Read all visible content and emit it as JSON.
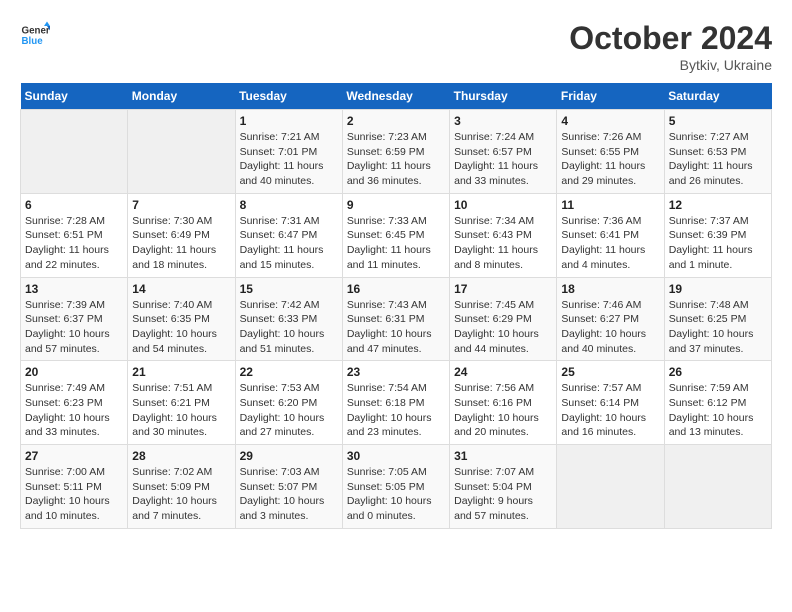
{
  "logo": {
    "line1": "General",
    "line2": "Blue"
  },
  "title": "October 2024",
  "subtitle": "Bytkiv, Ukraine",
  "weekdays": [
    "Sunday",
    "Monday",
    "Tuesday",
    "Wednesday",
    "Thursday",
    "Friday",
    "Saturday"
  ],
  "weeks": [
    [
      {
        "day": "",
        "sunrise": "",
        "sunset": "",
        "daylight": ""
      },
      {
        "day": "",
        "sunrise": "",
        "sunset": "",
        "daylight": ""
      },
      {
        "day": "1",
        "sunrise": "Sunrise: 7:21 AM",
        "sunset": "Sunset: 7:01 PM",
        "daylight": "Daylight: 11 hours and 40 minutes."
      },
      {
        "day": "2",
        "sunrise": "Sunrise: 7:23 AM",
        "sunset": "Sunset: 6:59 PM",
        "daylight": "Daylight: 11 hours and 36 minutes."
      },
      {
        "day": "3",
        "sunrise": "Sunrise: 7:24 AM",
        "sunset": "Sunset: 6:57 PM",
        "daylight": "Daylight: 11 hours and 33 minutes."
      },
      {
        "day": "4",
        "sunrise": "Sunrise: 7:26 AM",
        "sunset": "Sunset: 6:55 PM",
        "daylight": "Daylight: 11 hours and 29 minutes."
      },
      {
        "day": "5",
        "sunrise": "Sunrise: 7:27 AM",
        "sunset": "Sunset: 6:53 PM",
        "daylight": "Daylight: 11 hours and 26 minutes."
      }
    ],
    [
      {
        "day": "6",
        "sunrise": "Sunrise: 7:28 AM",
        "sunset": "Sunset: 6:51 PM",
        "daylight": "Daylight: 11 hours and 22 minutes."
      },
      {
        "day": "7",
        "sunrise": "Sunrise: 7:30 AM",
        "sunset": "Sunset: 6:49 PM",
        "daylight": "Daylight: 11 hours and 18 minutes."
      },
      {
        "day": "8",
        "sunrise": "Sunrise: 7:31 AM",
        "sunset": "Sunset: 6:47 PM",
        "daylight": "Daylight: 11 hours and 15 minutes."
      },
      {
        "day": "9",
        "sunrise": "Sunrise: 7:33 AM",
        "sunset": "Sunset: 6:45 PM",
        "daylight": "Daylight: 11 hours and 11 minutes."
      },
      {
        "day": "10",
        "sunrise": "Sunrise: 7:34 AM",
        "sunset": "Sunset: 6:43 PM",
        "daylight": "Daylight: 11 hours and 8 minutes."
      },
      {
        "day": "11",
        "sunrise": "Sunrise: 7:36 AM",
        "sunset": "Sunset: 6:41 PM",
        "daylight": "Daylight: 11 hours and 4 minutes."
      },
      {
        "day": "12",
        "sunrise": "Sunrise: 7:37 AM",
        "sunset": "Sunset: 6:39 PM",
        "daylight": "Daylight: 11 hours and 1 minute."
      }
    ],
    [
      {
        "day": "13",
        "sunrise": "Sunrise: 7:39 AM",
        "sunset": "Sunset: 6:37 PM",
        "daylight": "Daylight: 10 hours and 57 minutes."
      },
      {
        "day": "14",
        "sunrise": "Sunrise: 7:40 AM",
        "sunset": "Sunset: 6:35 PM",
        "daylight": "Daylight: 10 hours and 54 minutes."
      },
      {
        "day": "15",
        "sunrise": "Sunrise: 7:42 AM",
        "sunset": "Sunset: 6:33 PM",
        "daylight": "Daylight: 10 hours and 51 minutes."
      },
      {
        "day": "16",
        "sunrise": "Sunrise: 7:43 AM",
        "sunset": "Sunset: 6:31 PM",
        "daylight": "Daylight: 10 hours and 47 minutes."
      },
      {
        "day": "17",
        "sunrise": "Sunrise: 7:45 AM",
        "sunset": "Sunset: 6:29 PM",
        "daylight": "Daylight: 10 hours and 44 minutes."
      },
      {
        "day": "18",
        "sunrise": "Sunrise: 7:46 AM",
        "sunset": "Sunset: 6:27 PM",
        "daylight": "Daylight: 10 hours and 40 minutes."
      },
      {
        "day": "19",
        "sunrise": "Sunrise: 7:48 AM",
        "sunset": "Sunset: 6:25 PM",
        "daylight": "Daylight: 10 hours and 37 minutes."
      }
    ],
    [
      {
        "day": "20",
        "sunrise": "Sunrise: 7:49 AM",
        "sunset": "Sunset: 6:23 PM",
        "daylight": "Daylight: 10 hours and 33 minutes."
      },
      {
        "day": "21",
        "sunrise": "Sunrise: 7:51 AM",
        "sunset": "Sunset: 6:21 PM",
        "daylight": "Daylight: 10 hours and 30 minutes."
      },
      {
        "day": "22",
        "sunrise": "Sunrise: 7:53 AM",
        "sunset": "Sunset: 6:20 PM",
        "daylight": "Daylight: 10 hours and 27 minutes."
      },
      {
        "day": "23",
        "sunrise": "Sunrise: 7:54 AM",
        "sunset": "Sunset: 6:18 PM",
        "daylight": "Daylight: 10 hours and 23 minutes."
      },
      {
        "day": "24",
        "sunrise": "Sunrise: 7:56 AM",
        "sunset": "Sunset: 6:16 PM",
        "daylight": "Daylight: 10 hours and 20 minutes."
      },
      {
        "day": "25",
        "sunrise": "Sunrise: 7:57 AM",
        "sunset": "Sunset: 6:14 PM",
        "daylight": "Daylight: 10 hours and 16 minutes."
      },
      {
        "day": "26",
        "sunrise": "Sunrise: 7:59 AM",
        "sunset": "Sunset: 6:12 PM",
        "daylight": "Daylight: 10 hours and 13 minutes."
      }
    ],
    [
      {
        "day": "27",
        "sunrise": "Sunrise: 7:00 AM",
        "sunset": "Sunset: 5:11 PM",
        "daylight": "Daylight: 10 hours and 10 minutes."
      },
      {
        "day": "28",
        "sunrise": "Sunrise: 7:02 AM",
        "sunset": "Sunset: 5:09 PM",
        "daylight": "Daylight: 10 hours and 7 minutes."
      },
      {
        "day": "29",
        "sunrise": "Sunrise: 7:03 AM",
        "sunset": "Sunset: 5:07 PM",
        "daylight": "Daylight: 10 hours and 3 minutes."
      },
      {
        "day": "30",
        "sunrise": "Sunrise: 7:05 AM",
        "sunset": "Sunset: 5:05 PM",
        "daylight": "Daylight: 10 hours and 0 minutes."
      },
      {
        "day": "31",
        "sunrise": "Sunrise: 7:07 AM",
        "sunset": "Sunset: 5:04 PM",
        "daylight": "Daylight: 9 hours and 57 minutes."
      },
      {
        "day": "",
        "sunrise": "",
        "sunset": "",
        "daylight": ""
      },
      {
        "day": "",
        "sunrise": "",
        "sunset": "",
        "daylight": ""
      }
    ]
  ]
}
